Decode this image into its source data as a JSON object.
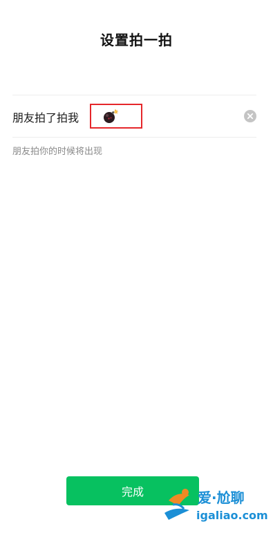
{
  "header": {
    "title": "设置拍一拍"
  },
  "field": {
    "label": "朋友拍了拍我",
    "value_icon": "bomb-icon",
    "clear_icon": "clear-icon",
    "highlight_color": "#e5262a"
  },
  "hint": {
    "text": "朋友拍你的时候将出现"
  },
  "footer": {
    "done_label": "完成",
    "button_color": "#07c160"
  },
  "watermark": {
    "text_cn": "爱·尬聊",
    "url": "igaliao.com",
    "color": "#1b8fd6"
  }
}
